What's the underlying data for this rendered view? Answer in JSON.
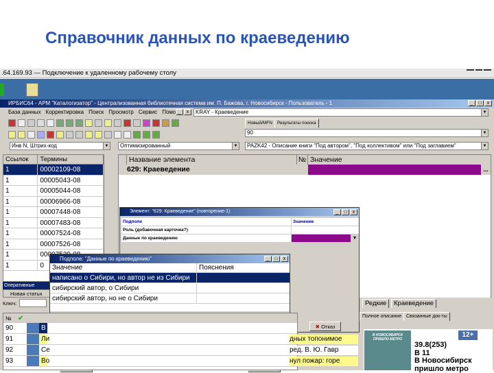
{
  "slide_title": "Справочник данных по краеведению",
  "rdp_title": ".64.169.93 — Подключение к удаленному рабочему столу",
  "app_title": "ИРБИС64 - АРМ \"Каталогизатор\" - Централизованная библиотечная система им. П. Бажова, г. Новосибирск - Пользователь - 1",
  "menu": [
    "База данных",
    "Корректировка",
    "Поиск",
    "Просмотр",
    "Сервис",
    "Помощь"
  ],
  "db_combo": "KRAY - Краеведение",
  "tabs": {
    "new_mfn": "Новый/MFN",
    "results": "Результаты поиска"
  },
  "mfn_value": "90",
  "search_combo": "Инв N, Штрих-код",
  "mode_combo": "Оптимизированный",
  "worksheet_combo": "PAZK42 - Описание книги \"Под автором\", \"Под коллективом\" или \"Под заглавием\"",
  "left_grid": {
    "headers": [
      "Ссылок",
      "Термины"
    ],
    "rows": [
      [
        "1",
        "00002109-08"
      ],
      [
        "1",
        "00005043-08"
      ],
      [
        "1",
        "00005044-08"
      ],
      [
        "1",
        "00006966-08"
      ],
      [
        "1",
        "00007448-08"
      ],
      [
        "1",
        "00007483-08"
      ],
      [
        "1",
        "00007524-08"
      ],
      [
        "1",
        "00007526-08"
      ],
      [
        "1",
        "00007529-08"
      ],
      [
        "1",
        "0"
      ]
    ]
  },
  "left_bottom": {
    "op": "Оперативные",
    "new_article": "Новая статья",
    "key_label": "Ключ:"
  },
  "right_grid": {
    "headers": [
      "Название элемента",
      "№",
      "Значение"
    ],
    "row": {
      "name": "629: Краеведение",
      "dots": "..."
    }
  },
  "dialog1": {
    "title": "Элемент: \"629: Краеведение\" (повторение-1)",
    "headers": [
      "Подполе",
      "Значение"
    ],
    "rows": [
      {
        "name": "Роль (добавочная карточка?)",
        "value": ""
      },
      {
        "name": "Данные по краеведению",
        "value": ""
      }
    ]
  },
  "dialog2": {
    "title": "Подполе: \"Данные по краеведению\"",
    "headers": [
      "Значение",
      "Пояснения"
    ],
    "rows": [
      "написано о Сибири, но автор не из Сибири",
      "сибирский автор, о Сибири",
      "сибирский автор, но не о Сибири"
    ]
  },
  "cancel_label": "Отказ",
  "bottom_tabs": {
    "rare": "Редкие",
    "local": "Краеведение"
  },
  "view_tabs": {
    "full": "Полное описание",
    "linked": "Связанные док-ты"
  },
  "bottom_grid": [
    {
      "n": "90",
      "text": "В"
    },
    {
      "n": "91",
      "text": "Ли"
    },
    {
      "n": "92",
      "text": "Се"
    },
    {
      "n": "93",
      "text": "Во"
    }
  ],
  "bottom_texts": [
    "дных топонимое",
    "ред. В. Ю. Гавр",
    "нул пожар: горе"
  ],
  "book": {
    "badge": "12+",
    "line1": "39.8(253)",
    "line2": "В 11",
    "line3": "В Новосибирск",
    "line4": "пришло метро",
    "cover": "В НОВОСИБИРСК ПРИШЛО МЕТРО"
  },
  "colors": {
    "selection": "#0a246a",
    "value_bar": "#8b0a8b",
    "title": "#2a55b4"
  }
}
